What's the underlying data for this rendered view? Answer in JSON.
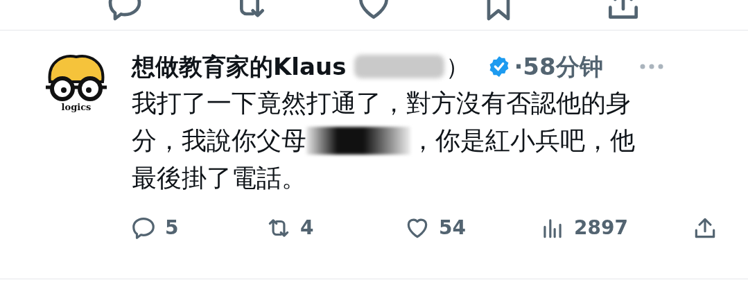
{
  "top_actions": [
    {
      "kind": "reply"
    },
    {
      "kind": "retweet"
    },
    {
      "kind": "like"
    },
    {
      "kind": "bookmark"
    },
    {
      "kind": "share"
    }
  ],
  "tweet": {
    "avatar_text": "logics",
    "author": "想做教育家的Klaus",
    "author_end": "）",
    "verified": true,
    "time": "·58分钟",
    "body_lines": [
      {
        "kind": "text",
        "text": "我打了一下竟然打通了，對方沒有否認他的身"
      },
      {
        "kind": "redacted",
        "before": "分，我說你父母",
        "after": "，你是紅小兵吧，他"
      },
      {
        "kind": "text",
        "text": "最後掛了電話。"
      }
    ],
    "actions": [
      {
        "kind": "reply",
        "count": "5"
      },
      {
        "kind": "retweet",
        "count": "4"
      },
      {
        "kind": "like",
        "count": "54"
      },
      {
        "kind": "views",
        "count": "2897"
      },
      {
        "kind": "share"
      }
    ]
  }
}
